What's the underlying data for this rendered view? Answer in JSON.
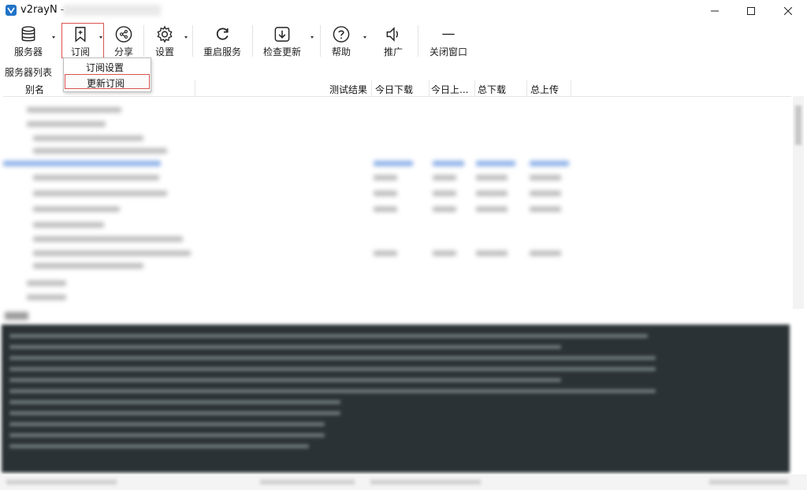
{
  "window": {
    "title": "v2rayN -",
    "controls": {
      "minimize": "minimize-icon",
      "maximize": "maximize-icon",
      "close": "close-icon"
    }
  },
  "toolbar": {
    "servers": {
      "label": "服务器",
      "icon": "database-icon"
    },
    "subscription": {
      "label": "订阅",
      "icon": "bookmark-plus-icon"
    },
    "share": {
      "label": "分享",
      "icon": "share-icon"
    },
    "settings": {
      "label": "设置",
      "icon": "gear-icon"
    },
    "restart": {
      "label": "重启服务",
      "icon": "refresh-icon"
    },
    "update": {
      "label": "检查更新",
      "icon": "download-icon"
    },
    "help": {
      "label": "帮助",
      "icon": "help-icon"
    },
    "promote": {
      "label": "推广",
      "icon": "speaker-icon"
    },
    "close_window": {
      "label": "关闭窗口",
      "icon": "minus-icon"
    }
  },
  "subscription_menu": {
    "items": [
      {
        "label": "订阅设置"
      },
      {
        "label": "更新订阅"
      }
    ]
  },
  "server_list": {
    "label": "服务器列表",
    "columns": [
      "别名",
      "测试结果",
      "今日下载",
      "今日上...",
      "总下载",
      "总上传"
    ]
  },
  "colors": {
    "accent_highlight": "#d9534f",
    "log_background": "#2b3235",
    "app_icon": "#1f73c7"
  }
}
